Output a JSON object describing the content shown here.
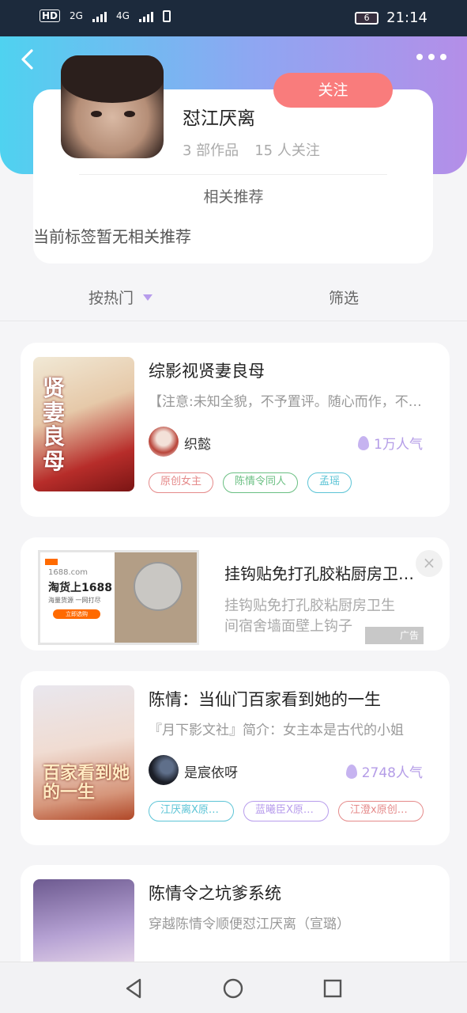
{
  "statusbar": {
    "network_left": "HD",
    "sim": "2",
    "net1": "2G",
    "net2": "4G",
    "battery": "6",
    "time": "21:14"
  },
  "header": {
    "back_icon": "chevron-left-icon",
    "more_icon": "more-horizontal-icon"
  },
  "tag_profile": {
    "name": "怼江厌离",
    "follow_label": "关注",
    "works": "3 部作品",
    "followers": "15 人关注",
    "related_title": "相关推荐",
    "related_empty": "当前标签暂无相关推荐"
  },
  "sort": {
    "hot_label": "按热门",
    "filter_label": "筛选"
  },
  "books": [
    {
      "title": "综影视贤妻良母",
      "desc": "【注意:未知全貌，不予置评。随心而作，不喜勿喷】",
      "cover_text": "贤妻良母",
      "author": "织懿",
      "popularity": "1万人气",
      "tags": [
        {
          "label": "原创女主",
          "color": "#e58a8a"
        },
        {
          "label": "陈情令同人",
          "color": "#6abf82"
        },
        {
          "label": "孟瑶",
          "color": "#5cc4d6"
        }
      ]
    },
    {
      "title": "陈情：当仙门百家看到她的一生",
      "desc": "『月下影文社』简介：女主本是古代的小姐",
      "cover_text": "百家看到她的一生",
      "author": "是宸依呀",
      "popularity": "2748人气",
      "tags": [
        {
          "label": "江厌离X原创男主",
          "color": "#5cc4d6"
        },
        {
          "label": "蓝曦臣X原创女主",
          "color": "#b79cec"
        },
        {
          "label": "江澄x原创女主",
          "color": "#e58a8a"
        }
      ]
    },
    {
      "title": "陈情令之坑爹系统",
      "desc": "穿越陈情令顺便怼江厌离（宣璐）",
      "cover_text": "",
      "author": "",
      "popularity": "",
      "tags": []
    }
  ],
  "ad": {
    "title": "挂钩贴免打孔胶粘厨房卫生间宿舍墙面壁上钩子",
    "desc": "挂钩贴免打孔胶粘厨房卫生间宿舍墙面壁上钩子",
    "badge": "广告",
    "image_site": "1688.com",
    "image_slogan": "淘货上1688",
    "image_sub": "海量货源 一网打尽",
    "image_btn": "立即选购"
  },
  "colors": {
    "accent_follow": "#f97c7c",
    "accent_purple": "#b79cec",
    "gradient_start": "#4fd2f0",
    "gradient_end": "#b48ee8"
  }
}
